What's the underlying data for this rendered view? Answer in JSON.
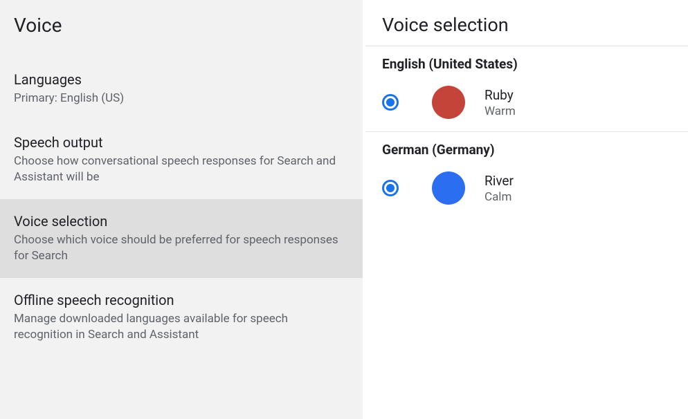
{
  "left": {
    "title": "Voice",
    "items": [
      {
        "title": "Languages",
        "subtitle": "Primary: English (US)",
        "selected": false
      },
      {
        "title": "Speech output",
        "subtitle": "Choose how conversational speech responses for Search and Assistant will be",
        "selected": false
      },
      {
        "title": "Voice selection",
        "subtitle": "Choose which voice should be preferred for speech responses for Search",
        "selected": true
      },
      {
        "title": "Offline speech recognition",
        "subtitle": "Manage downloaded languages available for speech recognition in Search and Assistant",
        "selected": false
      }
    ]
  },
  "right": {
    "title": "Voice selection",
    "groups": [
      {
        "header": "English (United States)",
        "voice": {
          "name": "Ruby",
          "desc": "Warm",
          "color": "#c5443a",
          "selected": true
        }
      },
      {
        "header": "German (Germany)",
        "voice": {
          "name": "River",
          "desc": "Calm",
          "color": "#2b6ef0",
          "selected": true
        }
      }
    ]
  }
}
